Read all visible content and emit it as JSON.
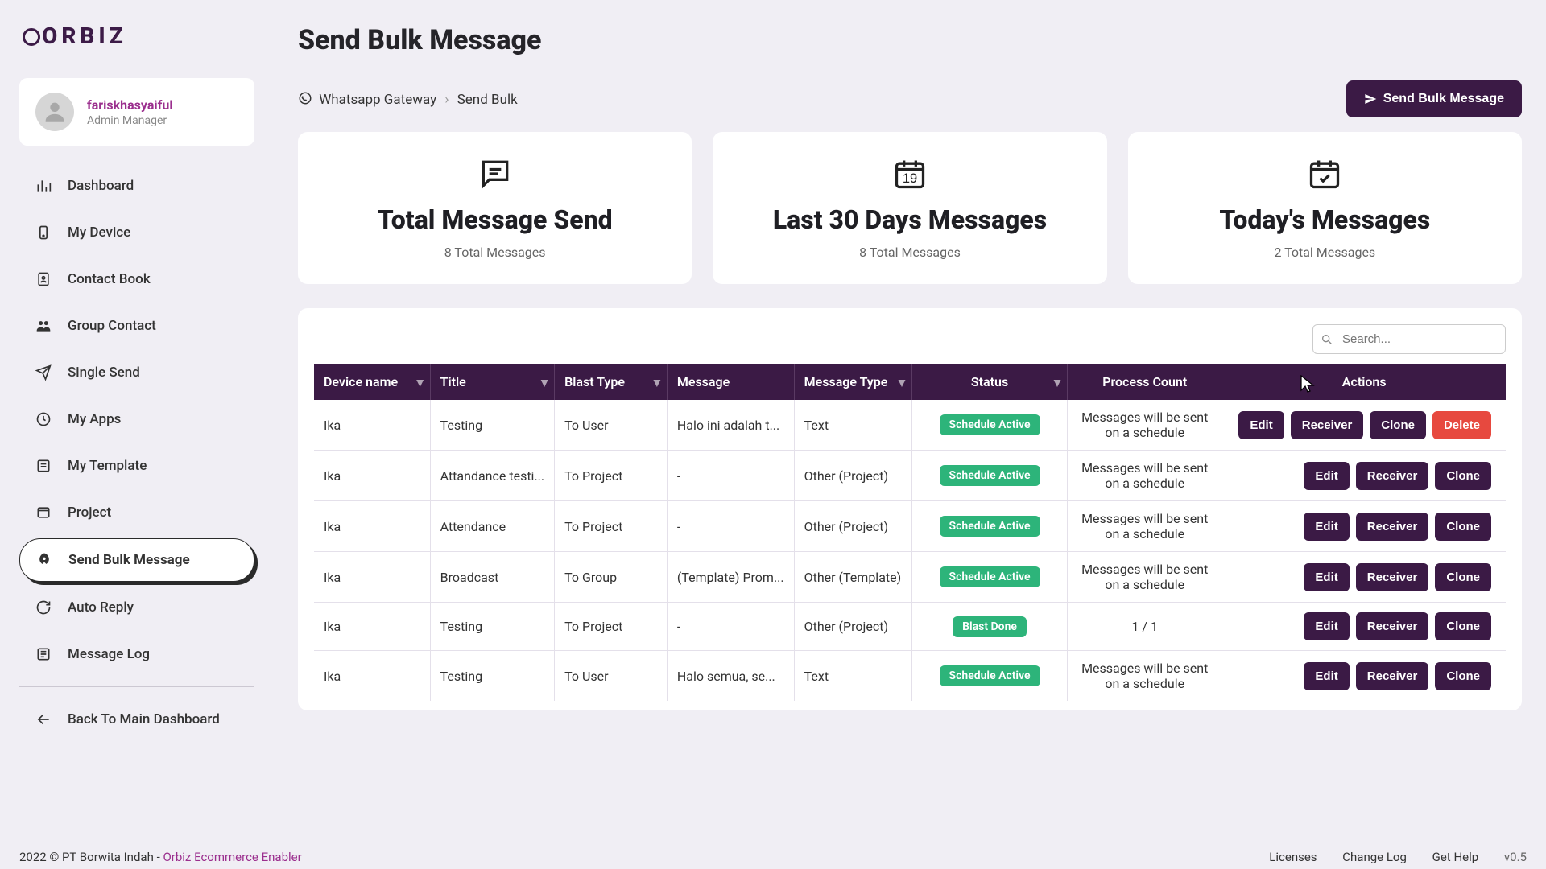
{
  "brand": "ORBIZ",
  "user": {
    "name": "fariskhasyaiful",
    "role": "Admin Manager"
  },
  "page_title": "Send Bulk Message",
  "breadcrumb": {
    "root": "Whatsapp Gateway",
    "leaf": "Send Bulk"
  },
  "action_button": "Send Bulk Message",
  "nav": {
    "dashboard": "Dashboard",
    "device": "My Device",
    "contact": "Contact Book",
    "group": "Group Contact",
    "single": "Single Send",
    "apps": "My Apps",
    "template": "My Template",
    "project": "Project",
    "bulk": "Send Bulk Message",
    "auto": "Auto Reply",
    "log": "Message Log",
    "back": "Back To Main Dashboard"
  },
  "stats": {
    "total": {
      "title": "Total Message Send",
      "sub": "8 Total Messages"
    },
    "last30": {
      "title": "Last 30 Days Messages",
      "sub": "8 Total Messages",
      "day": "19"
    },
    "today": {
      "title": "Today's Messages",
      "sub": "2 Total Messages"
    }
  },
  "search_placeholder": "Search...",
  "columns": {
    "device": "Device name",
    "title": "Title",
    "blast": "Blast Type",
    "message": "Message",
    "mtype": "Message Type",
    "status": "Status",
    "process": "Process Count",
    "actions": "Actions"
  },
  "status_text": {
    "active": "Schedule Active",
    "done": "Blast Done"
  },
  "process_text": "Messages will be sent on a schedule",
  "action_labels": {
    "edit": "Edit",
    "receiver": "Receiver",
    "clone": "Clone",
    "delete": "Delete"
  },
  "rows": [
    {
      "device": "Ika",
      "title": "Testing",
      "blast": "To User",
      "message": "Halo ini adalah t...",
      "mtype": "Text",
      "status": "active",
      "process": "sched",
      "delete": true
    },
    {
      "device": "Ika",
      "title": "Attandance testi...",
      "blast": "To Project",
      "message": "-",
      "mtype": "Other (Project)",
      "status": "active",
      "process": "sched",
      "delete": false
    },
    {
      "device": "Ika",
      "title": "Attendance",
      "blast": "To Project",
      "message": "-",
      "mtype": "Other (Project)",
      "status": "active",
      "process": "sched",
      "delete": false
    },
    {
      "device": "Ika",
      "title": "Broadcast",
      "blast": "To Group",
      "message": "(Template) Prom...",
      "mtype": "Other (Template)",
      "status": "active",
      "process": "sched",
      "delete": false
    },
    {
      "device": "Ika",
      "title": "Testing",
      "blast": "To Project",
      "message": "-",
      "mtype": "Other (Project)",
      "status": "done",
      "process": "1 / 1",
      "delete": false
    },
    {
      "device": "Ika",
      "title": "Testing",
      "blast": "To User",
      "message": "Halo semua, se...",
      "mtype": "Text",
      "status": "active",
      "process": "sched",
      "delete": false
    }
  ],
  "footer": {
    "left_prefix": "2022 © PT Borwita Indah - ",
    "left_link": "Orbiz Ecommerce Enabler",
    "licenses": "Licenses",
    "changelog": "Change Log",
    "help": "Get Help",
    "version": "v0.5"
  }
}
